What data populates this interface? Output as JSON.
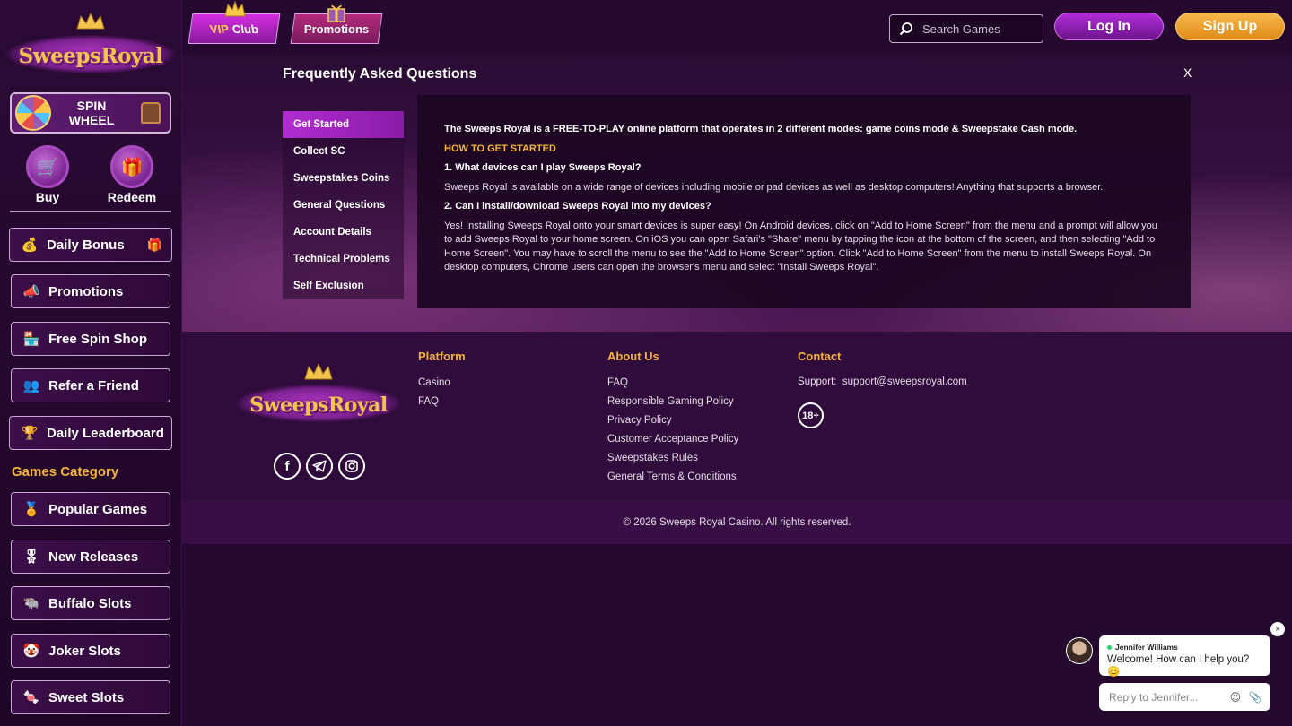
{
  "brand": {
    "name": "SweepsRoyal"
  },
  "sidebar": {
    "spin_wheel": {
      "label": "SPIN WHEEL"
    },
    "buy_label": "Buy",
    "redeem_label": "Redeem",
    "nav": [
      {
        "label": "Daily Bonus",
        "icon": "coin-bag-icon"
      },
      {
        "label": "Promotions",
        "icon": "megaphone-icon"
      },
      {
        "label": "Free Spin Shop",
        "icon": "shop-icon"
      },
      {
        "label": "Refer a Friend",
        "icon": "users-icon"
      },
      {
        "label": "Daily Leaderboard",
        "icon": "trophy-icon"
      }
    ],
    "games_category_title": "Games Category",
    "categories": [
      {
        "label": "Popular Games",
        "icon": "trophy-icon"
      },
      {
        "label": "New Releases",
        "icon": "badge-icon"
      },
      {
        "label": "Buffalo Slots",
        "icon": "buffalo-icon"
      },
      {
        "label": "Joker Slots",
        "icon": "joker-icon"
      },
      {
        "label": "Sweet Slots",
        "icon": "candy-icon"
      }
    ]
  },
  "header": {
    "vip_tab": {
      "vip": "VIP",
      "club": "Club"
    },
    "promotions_tab": "Promotions",
    "search": {
      "placeholder": "Search Games"
    },
    "login": "Log In",
    "signup": "Sign Up"
  },
  "faq": {
    "title": "Frequently Asked Questions",
    "close": "X",
    "menu": [
      "Get Started",
      "Collect SC",
      "Sweepstakes Coins",
      "General Questions",
      "Account Details",
      "Technical Problems",
      "Self Exclusion"
    ],
    "active_index": 0,
    "content": {
      "intro": "The Sweeps Royal is a FREE-TO-PLAY online platform that operates in 2 different modes: game coins mode & Sweepstake Cash mode.",
      "section_heading": "HOW TO GET STARTED",
      "q1": "1. What devices can I play Sweeps Royal?",
      "a1": "Sweeps Royal is available on a wide range of devices including mobile or pad devices as well as desktop computers! Anything that supports a browser.",
      "q2": "2. Can I install/download Sweeps Royal into my devices?",
      "a2": "Yes! Installing Sweeps Royal onto your smart devices is super easy! On Android devices, click on \"Add to Home Screen\" from the menu and a prompt will allow you to add Sweeps Royal to your home screen. On iOS you can open Safari's \"Share\" menu by tapping the icon at the bottom of the screen, and then selecting \"Add to Home Screen\". You may have to scroll the menu to see the \"Add to Home Screen\" option. Click \"Add to Home Screen\" from the menu to install Sweeps Royal. On desktop computers, Chrome users can open the browser's menu and select \"Install Sweeps Royal\"."
    }
  },
  "footer": {
    "platform": {
      "title": "Platform",
      "links": [
        "Casino",
        "FAQ"
      ]
    },
    "about": {
      "title": "About Us",
      "links": [
        "FAQ",
        "Responsible Gaming Policy",
        "Privacy Policy",
        "Customer Acceptance Policy",
        "Sweepstakes Rules",
        "General Terms & Conditions"
      ]
    },
    "contact": {
      "title": "Contact",
      "support_label": "Support:",
      "support_email": "support@sweepsroyal.com",
      "age_badge": "18+"
    },
    "copyright": "© 2026 Sweeps Royal Casino. All rights reserved."
  },
  "chat": {
    "agent_name": "Jennifer Williams",
    "message": "Welcome! How can I help you? 😊",
    "input_placeholder": "Reply to Jennifer...",
    "close": "×"
  },
  "colors": {
    "accent_gold": "#f3b436",
    "accent_purple": "#b12cd8",
    "background": "#26092f"
  }
}
